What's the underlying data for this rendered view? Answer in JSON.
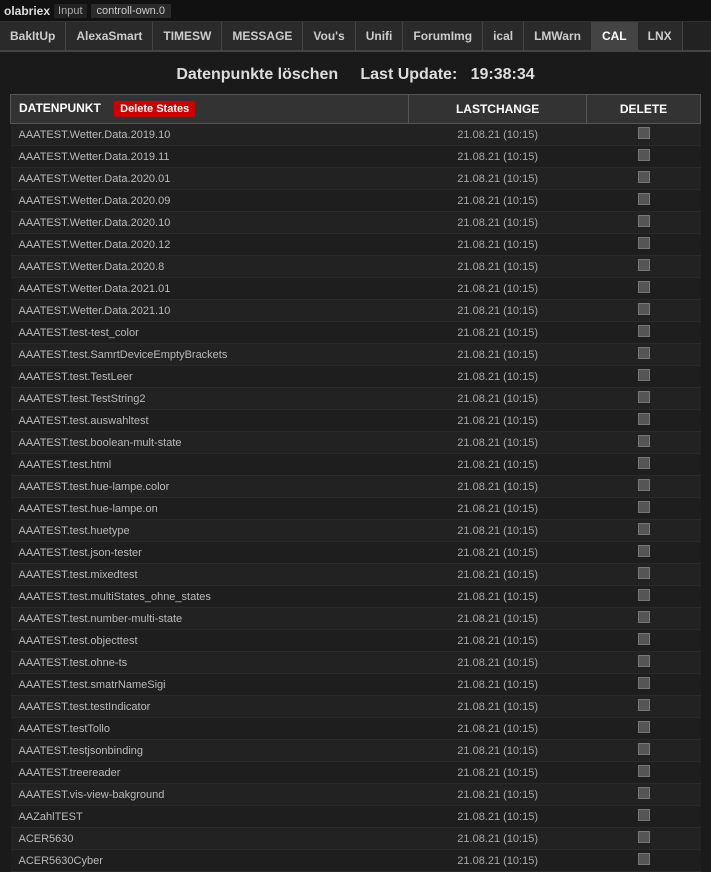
{
  "topbar": {
    "name": "olabriex",
    "input_label": "Input",
    "control_value": "controll-own.0"
  },
  "nav": {
    "tabs": [
      {
        "label": "BakItUp",
        "active": false
      },
      {
        "label": "AlexaSmart",
        "active": false
      },
      {
        "label": "TIMESW",
        "active": false
      },
      {
        "label": "MESSAGE",
        "active": false
      },
      {
        "label": "Vou's",
        "active": false
      },
      {
        "label": "Unifi",
        "active": false
      },
      {
        "label": "ForumImg",
        "active": false
      },
      {
        "label": "ical",
        "active": false
      },
      {
        "label": "LMWarn",
        "active": false
      },
      {
        "label": "CAL",
        "active": true
      },
      {
        "label": "LNX",
        "active": false
      }
    ]
  },
  "page": {
    "title": "Datenpunkte löschen",
    "last_update_label": "Last Update:",
    "last_update_time": "19:38:34"
  },
  "table": {
    "col_datenpunkt": "DATENPUNKT",
    "col_delete_states_btn": "Delete States",
    "col_lastchange": "LASTCHANGE",
    "col_delete": "DELETE",
    "rows": [
      {
        "name": "AAATEST.Wetter.Data.2019.10",
        "lastchange": "21.08.21 (10:15)"
      },
      {
        "name": "AAATEST.Wetter.Data.2019.11",
        "lastchange": "21.08.21 (10:15)"
      },
      {
        "name": "AAATEST.Wetter.Data.2020.01",
        "lastchange": "21.08.21 (10:15)"
      },
      {
        "name": "AAATEST.Wetter.Data.2020.09",
        "lastchange": "21.08.21 (10:15)"
      },
      {
        "name": "AAATEST.Wetter.Data.2020.10",
        "lastchange": "21.08.21 (10:15)"
      },
      {
        "name": "AAATEST.Wetter.Data.2020.12",
        "lastchange": "21.08.21 (10:15)"
      },
      {
        "name": "AAATEST.Wetter.Data.2020.8",
        "lastchange": "21.08.21 (10:15)"
      },
      {
        "name": "AAATEST.Wetter.Data.2021.01",
        "lastchange": "21.08.21 (10:15)"
      },
      {
        "name": "AAATEST.Wetter.Data.2021.10",
        "lastchange": "21.08.21 (10:15)"
      },
      {
        "name": "AAATEST.test-test_color",
        "lastchange": "21.08.21 (10:15)"
      },
      {
        "name": "AAATEST.test.SamrtDeviceEmptyBrackets",
        "lastchange": "21.08.21 (10:15)"
      },
      {
        "name": "AAATEST.test.TestLeer",
        "lastchange": "21.08.21 (10:15)"
      },
      {
        "name": "AAATEST.test.TestString2",
        "lastchange": "21.08.21 (10:15)"
      },
      {
        "name": "AAATEST.test.auswahltest",
        "lastchange": "21.08.21 (10:15)"
      },
      {
        "name": "AAATEST.test.boolean-mult-state",
        "lastchange": "21.08.21 (10:15)"
      },
      {
        "name": "AAATEST.test.html",
        "lastchange": "21.08.21 (10:15)"
      },
      {
        "name": "AAATEST.test.hue-lampe.color",
        "lastchange": "21.08.21 (10:15)"
      },
      {
        "name": "AAATEST.test.hue-lampe.on",
        "lastchange": "21.08.21 (10:15)"
      },
      {
        "name": "AAATEST.test.huetype",
        "lastchange": "21.08.21 (10:15)"
      },
      {
        "name": "AAATEST.test.json-tester",
        "lastchange": "21.08.21 (10:15)"
      },
      {
        "name": "AAATEST.test.mixedtest",
        "lastchange": "21.08.21 (10:15)"
      },
      {
        "name": "AAATEST.test.multiStates_ohne_states",
        "lastchange": "21.08.21 (10:15)"
      },
      {
        "name": "AAATEST.test.number-multi-state",
        "lastchange": "21.08.21 (10:15)"
      },
      {
        "name": "AAATEST.test.objecttest",
        "lastchange": "21.08.21 (10:15)"
      },
      {
        "name": "AAATEST.test.ohne-ts",
        "lastchange": "21.08.21 (10:15)"
      },
      {
        "name": "AAATEST.test.smatrNameSigi",
        "lastchange": "21.08.21 (10:15)"
      },
      {
        "name": "AAATEST.test.testIndicator",
        "lastchange": "21.08.21 (10:15)"
      },
      {
        "name": "AAATEST.testTollo",
        "lastchange": "21.08.21 (10:15)"
      },
      {
        "name": "AAATEST.testjsonbinding",
        "lastchange": "21.08.21 (10:15)"
      },
      {
        "name": "AAATEST.treereader",
        "lastchange": "21.08.21 (10:15)"
      },
      {
        "name": "AAATEST.vis-view-bakground",
        "lastchange": "21.08.21 (10:15)"
      },
      {
        "name": "AAZahlTEST",
        "lastchange": "21.08.21 (10:15)"
      },
      {
        "name": "ACER5630",
        "lastchange": "21.08.21 (10:15)"
      },
      {
        "name": "ACER5630Cyber",
        "lastchange": "21.08.21 (10:15)"
      }
    ]
  }
}
